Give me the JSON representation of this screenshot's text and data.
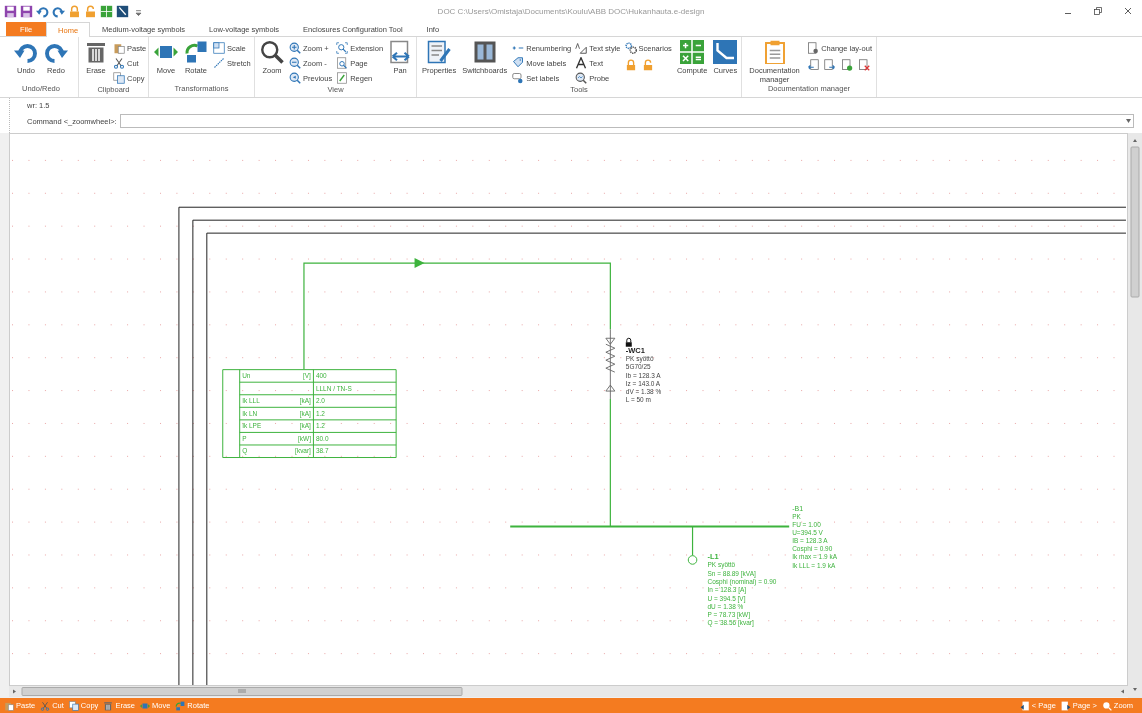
{
  "window": {
    "title": "DOC C:\\Users\\Omistaja\\Documents\\Koulu\\ABB DOC\\Hukanhauta.e-design"
  },
  "tabs": [
    {
      "label": "File",
      "kind": "file",
      "selected": false
    },
    {
      "label": "Home",
      "kind": "tab",
      "selected": true
    },
    {
      "label": "Medium-voltage symbols",
      "kind": "tab",
      "selected": false
    },
    {
      "label": "Low-voltage symbols",
      "kind": "tab",
      "selected": false
    },
    {
      "label": "Enclosures Configuration Tool",
      "kind": "tab",
      "selected": false
    },
    {
      "label": "Info",
      "kind": "tab",
      "selected": false
    }
  ],
  "ribbon": [
    {
      "label": "Undo/Redo",
      "items": [
        {
          "kind": "large",
          "label": "Undo"
        },
        {
          "kind": "large",
          "label": "Redo"
        }
      ]
    },
    {
      "label": "Clipboard",
      "items": [
        {
          "kind": "large",
          "label": "Erase"
        },
        {
          "kind": "column",
          "items": [
            {
              "kind": "small",
              "label": "Paste"
            },
            {
              "kind": "small",
              "label": "Cut"
            },
            {
              "kind": "small",
              "label": "Copy"
            }
          ]
        }
      ]
    },
    {
      "label": "Transformations",
      "items": [
        {
          "kind": "large",
          "label": "Move"
        },
        {
          "kind": "large",
          "label": "Rotate"
        },
        {
          "kind": "column",
          "items": [
            {
              "kind": "small",
              "label": "Scale"
            },
            {
              "kind": "small",
              "label": "Stretch"
            }
          ]
        }
      ]
    },
    {
      "label": "View",
      "items": [
        {
          "kind": "large",
          "label": "Zoom"
        },
        {
          "kind": "column",
          "items": [
            {
              "kind": "small",
              "label": "Zoom +"
            },
            {
              "kind": "small",
              "label": "Zoom -"
            },
            {
              "kind": "small",
              "label": "Previous"
            }
          ]
        },
        {
          "kind": "column",
          "items": [
            {
              "kind": "small",
              "label": "Extension"
            },
            {
              "kind": "small",
              "label": "Page"
            },
            {
              "kind": "small",
              "label": "Regen"
            }
          ]
        },
        {
          "kind": "large",
          "label": "Pan"
        }
      ]
    },
    {
      "label": "Tools",
      "items": [
        {
          "kind": "large",
          "label": "Properties"
        },
        {
          "kind": "large",
          "label": "Switchboards"
        },
        {
          "kind": "column",
          "items": [
            {
              "kind": "small",
              "label": "Renumbering"
            },
            {
              "kind": "small",
              "label": "Move labels"
            },
            {
              "kind": "small",
              "label": "Set labels"
            }
          ]
        },
        {
          "kind": "column",
          "items": [
            {
              "kind": "small",
              "label": "Text style"
            },
            {
              "kind": "small",
              "label": "Text"
            },
            {
              "kind": "small",
              "label": "Probe"
            }
          ]
        },
        {
          "kind": "column",
          "items": [
            {
              "kind": "small",
              "label": "Scenarios"
            },
            {
              "kind": "icons"
            }
          ]
        },
        {
          "kind": "large",
          "label": "Compute"
        },
        {
          "kind": "large",
          "label": "Curves"
        }
      ]
    },
    {
      "label": "Documentation manager",
      "items": [
        {
          "kind": "large",
          "label": "Documentation manager"
        },
        {
          "kind": "column",
          "items": [
            {
              "kind": "small",
              "label": "Change lay-out"
            },
            {
              "kind": "icons"
            }
          ]
        }
      ]
    }
  ],
  "command": {
    "output": "wr: 1.5",
    "prompt": "Command <_zoomwheel>:"
  },
  "drawing": {
    "source_table": [
      {
        "label": "Un",
        "unit": "[V]",
        "value": "400"
      },
      {
        "value": "LLLN / TN-S"
      },
      {
        "label": "Ik LLL",
        "unit": "[kA]",
        "value": "2.0"
      },
      {
        "label": "Ik LN",
        "unit": "[kA]",
        "value": "1.2"
      },
      {
        "label": "Ik LPE",
        "unit": "[kA]",
        "value": "1.2"
      },
      {
        "label": "P",
        "unit": "[kW]",
        "value": "80.0"
      },
      {
        "label": "Q",
        "unit": "[kvar]",
        "value": "38.7"
      }
    ],
    "cable": {
      "tag": "-WC1",
      "lines": [
        "PK syöttö",
        "5G70/25",
        "Ib = 128.3 A",
        "Iz = 143.0 A",
        "dV = 1.38 %",
        "L = 50 m"
      ]
    },
    "busbar": {
      "tag": "-B1",
      "lines": [
        "PK",
        "FU = 1.00",
        "U=394.5 V",
        "IB = 128.3 A",
        "Cosphi = 0.90",
        "Ik max = 1.9 kA",
        "Ik LLL = 1.9 kA"
      ]
    },
    "load": {
      "tag": "-L1",
      "lines": [
        "PK syöttö",
        "Sn = 88.89 [kVA]",
        "Cosphi (nominal) = 0.90",
        "In = 128.3 [A]",
        "U = 394.5 [V]",
        "dU = 1.38 %",
        "P = 78.73 [kW]",
        "Q = 38.56 [kvar]"
      ]
    }
  },
  "status_bar": {
    "left": [
      {
        "label": "Paste"
      },
      {
        "label": "Cut"
      },
      {
        "label": "Copy"
      },
      {
        "label": "Erase"
      },
      {
        "label": "Move"
      },
      {
        "label": "Rotate"
      }
    ],
    "right": [
      {
        "label": "< Page"
      },
      {
        "label": "Page >"
      },
      {
        "label": "Zoom"
      }
    ]
  }
}
